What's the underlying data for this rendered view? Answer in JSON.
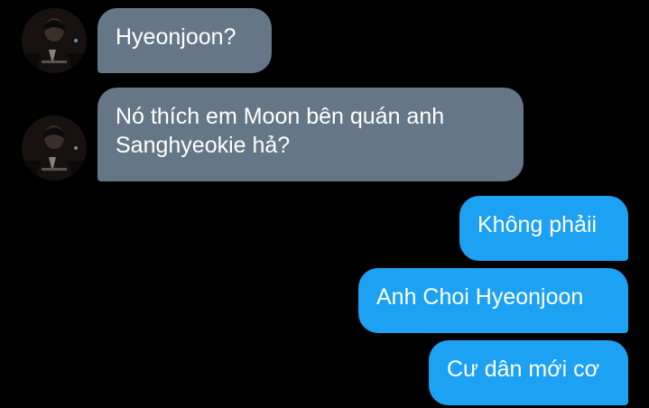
{
  "conversation": {
    "incoming": [
      {
        "lines": [
          "Hyeonjoon?"
        ],
        "avatar_icon": "profile-photo"
      },
      {
        "lines": [
          "Nó thích em Moon bên quán anh",
          "Sanghyeokie hả?"
        ],
        "avatar_icon": "profile-photo"
      }
    ],
    "outgoing": [
      {
        "text": "Không phảii"
      },
      {
        "text": "Anh Choi Hyeonjoon"
      },
      {
        "text": "Cư dân mới cơ"
      }
    ]
  },
  "colors": {
    "background": "#000000",
    "incoming_bubble": "#657786",
    "outgoing_bubble": "#1da1f2",
    "text": "#ffffff"
  }
}
